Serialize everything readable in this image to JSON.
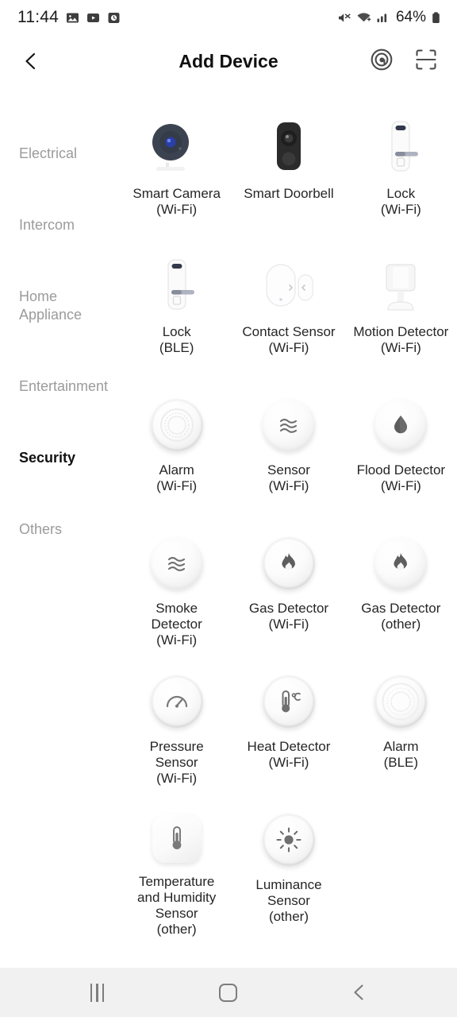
{
  "status_bar": {
    "time": "11:44",
    "battery_percent": "64%",
    "left_icons": [
      "gallery-icon",
      "video-player-icon",
      "alarm-clock-icon"
    ],
    "right_icons": [
      "mute-icon",
      "wifi-icon",
      "cellular-signal-icon",
      "battery-icon"
    ]
  },
  "app_bar": {
    "title": "Add Device",
    "back_label": "Back",
    "actions": [
      "radar-scan-icon",
      "qr-scan-icon"
    ]
  },
  "sidebar": {
    "items": [
      {
        "label": "Electrical",
        "active": false
      },
      {
        "label": "Intercom",
        "active": false
      },
      {
        "label": "Home Appliance",
        "active": false
      },
      {
        "label": "Entertainment",
        "active": false
      },
      {
        "label": "Security",
        "active": true
      },
      {
        "label": "Others",
        "active": false
      }
    ]
  },
  "devices": [
    {
      "name": "Smart Camera",
      "variant": "(Wi-Fi)",
      "icon": "smart-camera-icon"
    },
    {
      "name": "Smart Doorbell",
      "variant": "",
      "icon": "smart-doorbell-icon"
    },
    {
      "name": "Lock",
      "variant": "(Wi-Fi)",
      "icon": "door-lock-icon"
    },
    {
      "name": "Lock",
      "variant": "(BLE)",
      "icon": "door-lock-icon"
    },
    {
      "name": "Contact Sensor",
      "variant": "(Wi-Fi)",
      "icon": "contact-sensor-icon"
    },
    {
      "name": "Motion Detector",
      "variant": "(Wi-Fi)",
      "icon": "motion-detector-icon"
    },
    {
      "name": "Alarm",
      "variant": "(Wi-Fi)",
      "icon": "alarm-puck-icon"
    },
    {
      "name": "Sensor",
      "variant": "(Wi-Fi)",
      "icon": "wave-sensor-icon"
    },
    {
      "name": "Flood Detector",
      "variant": "(Wi-Fi)",
      "icon": "water-drop-icon"
    },
    {
      "name": "Smoke Detector",
      "variant": "(Wi-Fi)",
      "icon": "wave-sensor-icon"
    },
    {
      "name": "Gas Detector",
      "variant": "(Wi-Fi)",
      "icon": "flame-icon"
    },
    {
      "name": "Gas Detector",
      "variant": "(other)",
      "icon": "flame-icon"
    },
    {
      "name": "Pressure Sensor",
      "variant": "(Wi-Fi)",
      "icon": "gauge-icon"
    },
    {
      "name": "Heat Detector",
      "variant": "(Wi-Fi)",
      "icon": "thermometer-celsius-icon"
    },
    {
      "name": "Alarm",
      "variant": "(BLE)",
      "icon": "alarm-puck-icon"
    },
    {
      "name": "Temperature and Humidity Sensor",
      "variant": "(other)",
      "icon": "thermometer-square-icon"
    },
    {
      "name": "Luminance Sensor",
      "variant": "(other)",
      "icon": "sun-icon"
    }
  ],
  "nav_bar": {
    "recents_label": "Recents",
    "home_label": "Home",
    "back_label": "Back"
  },
  "colors": {
    "text_primary": "#262626",
    "text_muted": "#9b9b9b",
    "nav_background": "#f1f1f1",
    "camera_body": "#3c4350",
    "lens_blue": "#2b3fa8"
  }
}
